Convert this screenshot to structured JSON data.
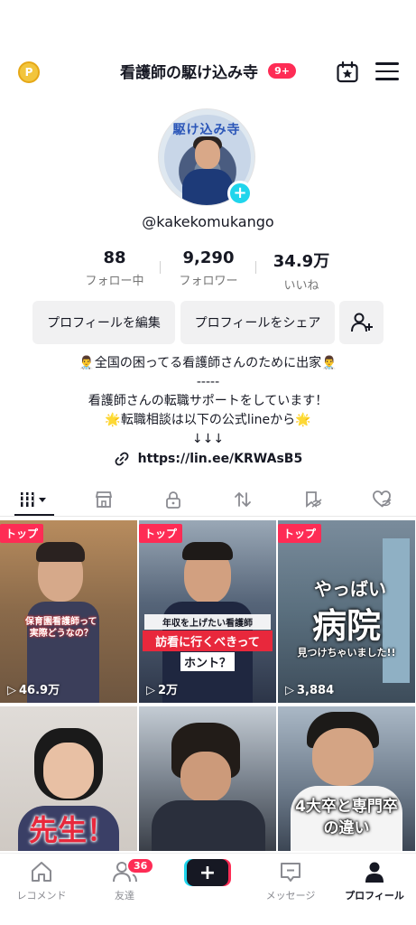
{
  "header": {
    "title": "看護師の駆け込み寺",
    "notification_count": "9+",
    "coin_label": "P"
  },
  "profile": {
    "avatar_text": "駆け込み寺",
    "username": "@kakekomukango"
  },
  "stats": [
    {
      "value": "88",
      "label": "フォロー中"
    },
    {
      "value": "9,290",
      "label": "フォロワー"
    },
    {
      "value": "34.9万",
      "label": "いいね"
    }
  ],
  "buttons": {
    "edit_profile": "プロフィールを編集",
    "share_profile": "プロフィールをシェア"
  },
  "bio": {
    "line1": "👨‍⚕️全国の困ってる看護師さんのために出家👨‍⚕️",
    "line2": "-----",
    "line3": "看護師さんの転職サポートをしています！",
    "line4": "🌟転職相談は以下の公式lineから🌟",
    "line5": "↓↓↓",
    "link": "https://lin.ee/KRWAsB5"
  },
  "videos": [
    {
      "badge": "トップ",
      "views": "46.9万",
      "caption": "保育園看護師って\n実際どうなの？",
      "bg": "#8a6a4a"
    },
    {
      "badge": "トップ",
      "views": "2万",
      "caption_a": "年収を上げたい看護師",
      "caption_b": "訪看に行くべきって",
      "caption_c": "ホント？",
      "bg": "#3c4a5e"
    },
    {
      "badge": "トップ",
      "views": "3,884",
      "caption_a": "やっばい",
      "caption_b": "病院",
      "caption_c": "見つけちゃいました!!",
      "bg": "#5a6f7e"
    },
    {
      "caption": "先生！",
      "bg": "#d4d0cc"
    },
    {
      "caption": "",
      "bg": "#6e7680"
    },
    {
      "caption_a": "4大卒と専門卒",
      "caption_b": "の違い",
      "bg": "#4c5a68"
    }
  ],
  "nav": {
    "home": "レコメンド",
    "friends": "友達",
    "friends_badge": "36",
    "create": "+",
    "inbox": "メッセージ",
    "profile": "プロフィール"
  },
  "colors": {
    "accent": "#fe2c55",
    "cyan": "#20d5ec"
  }
}
